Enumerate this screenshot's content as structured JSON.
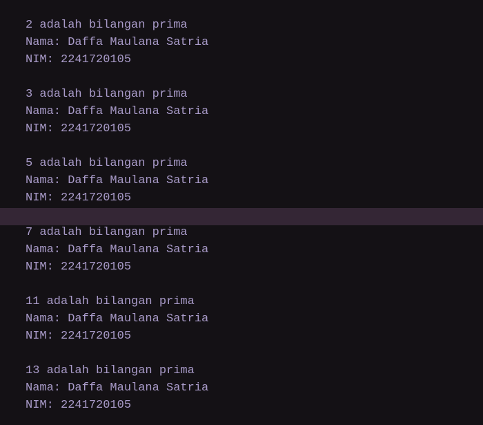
{
  "colors": {
    "background": "#141115",
    "text": "#a99bc9",
    "highlight_row": "#342635"
  },
  "output": {
    "lines": [
      "2 adalah bilangan prima",
      "Nama: Daffa Maulana Satria",
      "NIM: 2241720105",
      "",
      "3 adalah bilangan prima",
      "Nama: Daffa Maulana Satria",
      "NIM: 2241720105",
      "",
      "5 adalah bilangan prima",
      "Nama: Daffa Maulana Satria",
      "NIM: 2241720105",
      "",
      "7 adalah bilangan prima",
      "Nama: Daffa Maulana Satria",
      "NIM: 2241720105",
      "",
      "11 adalah bilangan prima",
      "Nama: Daffa Maulana Satria",
      "NIM: 2241720105",
      "",
      "13 adalah bilangan prima",
      "Nama: Daffa Maulana Satria",
      "NIM: 2241720105"
    ]
  }
}
